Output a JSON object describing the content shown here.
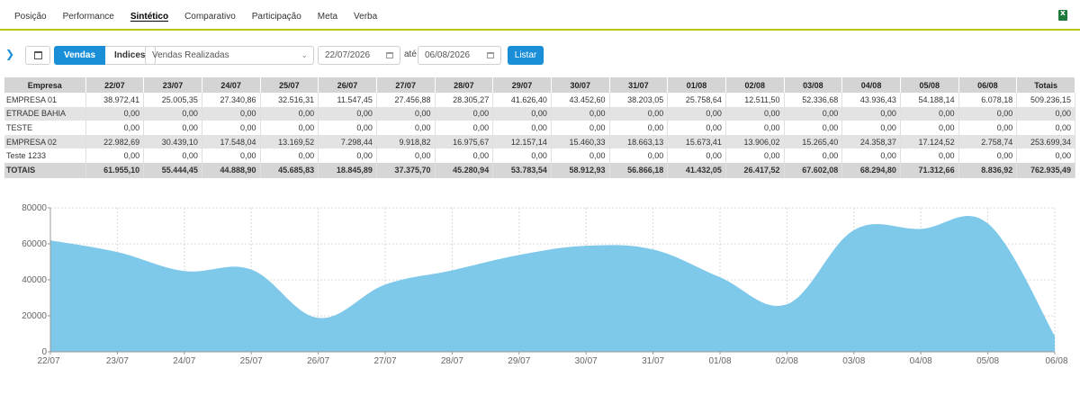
{
  "nav": {
    "tabs": [
      "Posição",
      "Performance",
      "Sintético",
      "Comparativo",
      "Participação",
      "Meta",
      "Verba"
    ],
    "active": "Sintético"
  },
  "toolbar": {
    "vendas_label": "Vendas",
    "indices_label": "Indices",
    "select_value": "Vendas Realizadas",
    "date_from": "22/07/2026",
    "ate_label": "até",
    "date_to": "06/08/2026",
    "listar_label": "Listar"
  },
  "table": {
    "headers": [
      "Empresa",
      "22/07",
      "23/07",
      "24/07",
      "25/07",
      "26/07",
      "27/07",
      "28/07",
      "29/07",
      "30/07",
      "31/07",
      "01/08",
      "02/08",
      "03/08",
      "04/08",
      "05/08",
      "06/08",
      "Totais"
    ],
    "rows": [
      [
        "EMPRESA 01",
        "38.972,41",
        "25.005,35",
        "27.340,86",
        "32.516,31",
        "11.547,45",
        "27.456,88",
        "28.305,27",
        "41.626,40",
        "43.452,60",
        "38.203,05",
        "25.758,64",
        "12.511,50",
        "52.336,68",
        "43.936,43",
        "54.188,14",
        "6.078,18",
        "509.236,15"
      ],
      [
        "ETRADE BAHIA",
        "0,00",
        "0,00",
        "0,00",
        "0,00",
        "0,00",
        "0,00",
        "0,00",
        "0,00",
        "0,00",
        "0,00",
        "0,00",
        "0,00",
        "0,00",
        "0,00",
        "0,00",
        "0,00",
        "0,00"
      ],
      [
        "TESTE",
        "0,00",
        "0,00",
        "0,00",
        "0,00",
        "0,00",
        "0,00",
        "0,00",
        "0,00",
        "0,00",
        "0,00",
        "0,00",
        "0,00",
        "0,00",
        "0,00",
        "0,00",
        "0,00",
        "0,00"
      ],
      [
        "EMPRESA 02",
        "22.982,69",
        "30.439,10",
        "17.548,04",
        "13.169,52",
        "7.298,44",
        "9.918,82",
        "16.975,67",
        "12.157,14",
        "15.460,33",
        "18.663,13",
        "15.673,41",
        "13.906,02",
        "15.265,40",
        "24.358,37",
        "17.124,52",
        "2.758,74",
        "253.699,34"
      ],
      [
        "Teste 1233",
        "0,00",
        "0,00",
        "0,00",
        "0,00",
        "0,00",
        "0,00",
        "0,00",
        "0,00",
        "0,00",
        "0,00",
        "0,00",
        "0,00",
        "0,00",
        "0,00",
        "0,00",
        "0,00",
        "0,00"
      ]
    ],
    "totals": [
      "TOTAIS",
      "61.955,10",
      "55.444,45",
      "44.888,90",
      "45.685,83",
      "18.845,89",
      "37.375,70",
      "45.280,94",
      "53.783,54",
      "58.912,93",
      "56.866,18",
      "41.432,05",
      "26.417,52",
      "67.602,08",
      "68.294,80",
      "71.312,66",
      "8.836,92",
      "762.935,49"
    ]
  },
  "colors": {
    "accent": "#1a8fd8",
    "area": "#7ec8ea",
    "nav_underline": "#b8c400"
  },
  "chart_data": {
    "type": "area",
    "x": [
      "22/07",
      "23/07",
      "24/07",
      "25/07",
      "26/07",
      "27/07",
      "28/07",
      "29/07",
      "30/07",
      "31/07",
      "01/08",
      "02/08",
      "03/08",
      "04/08",
      "05/08",
      "06/08"
    ],
    "values": [
      61955.1,
      55444.45,
      44888.9,
      45685.83,
      18845.89,
      37375.7,
      45280.94,
      53783.54,
      58912.93,
      56866.18,
      41432.05,
      26417.52,
      67602.08,
      68294.8,
      71312.66,
      8836.92
    ],
    "ylim": [
      0,
      80000
    ],
    "yticks": [
      "0",
      "20000",
      "40000",
      "60000",
      "80000"
    ],
    "grid": true
  }
}
